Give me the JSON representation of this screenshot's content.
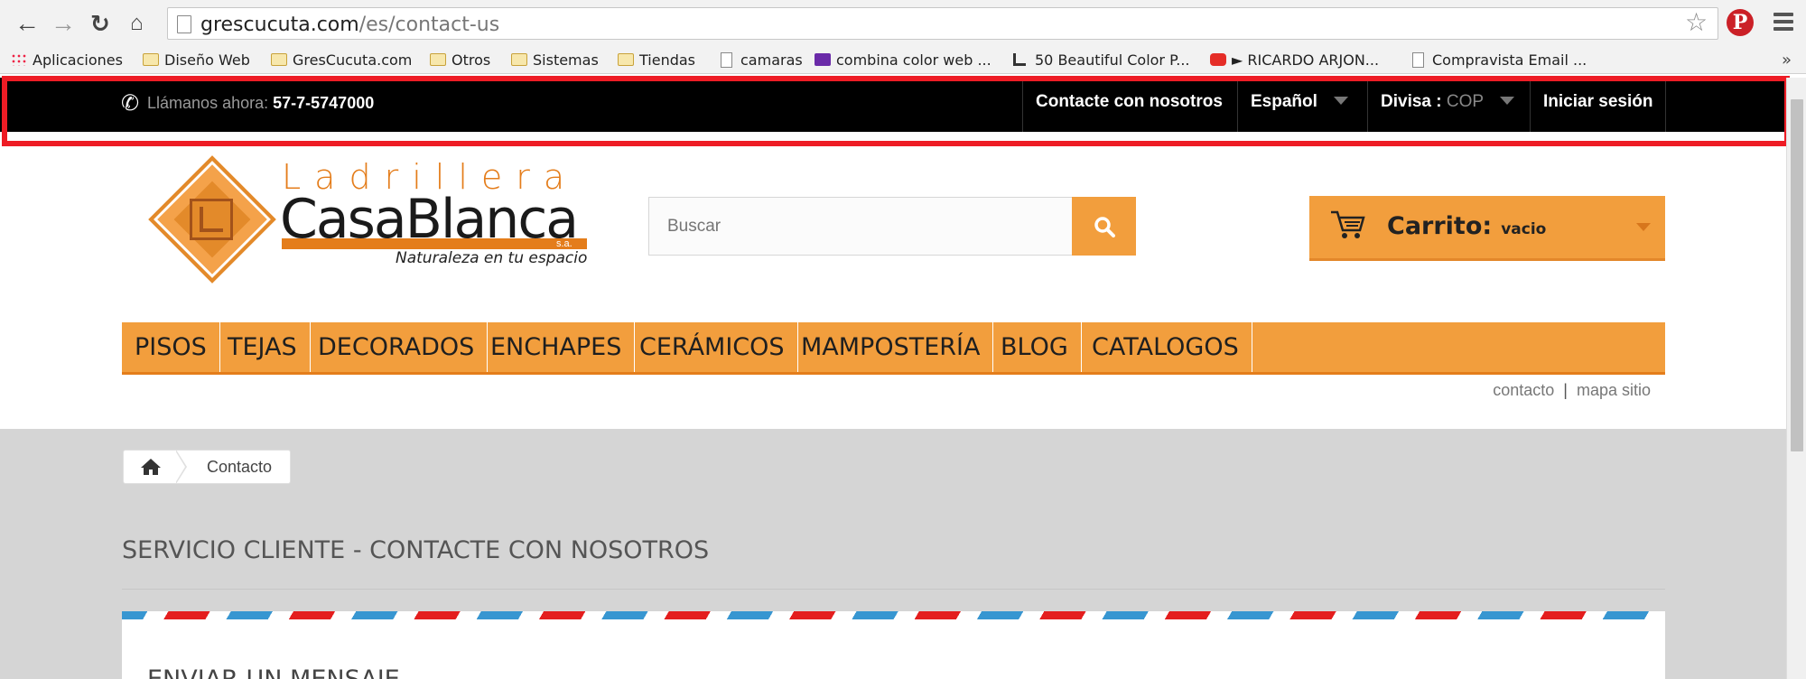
{
  "browser": {
    "url_domain": "grescucuta.com",
    "url_path": "/es/contact-us",
    "bookmarks": [
      "Aplicaciones",
      "Diseño Web",
      "GresCucuta.com",
      "Otros",
      "Sistemas",
      "Tiendas",
      "camaras",
      "combina color web ...",
      "50 Beautiful Color P...",
      "► RICARDO ARJON...",
      "Compravista Email ..."
    ],
    "pinterest_glyph": "P",
    "more_glyph": "»"
  },
  "topbar": {
    "call_label": "Llámanos ahora:",
    "phone": "57-7-5747000",
    "contact": "Contacte con nosotros",
    "language": "Español",
    "currency_label": "Divisa :",
    "currency_value": "COP",
    "login": "Iniciar sesión",
    "highlight_color": "#ee1c25"
  },
  "logo": {
    "line1": "Ladrillera",
    "line2": "CasaBlanca",
    "suffix": "s.a.",
    "tagline": "Naturaleza en tu espacio"
  },
  "search": {
    "placeholder": "Buscar",
    "icon": "search-icon"
  },
  "cart": {
    "label": "Carrito:",
    "value": "vacio",
    "icon": "cart-icon"
  },
  "menu": {
    "items": [
      "PISOS",
      "TEJAS",
      "DECORADOS",
      "ENCHAPES",
      "CERÁMICOS",
      "MAMPOSTERÍA",
      "BLOG",
      "CATALOGOS"
    ],
    "accent": "#f29e3d"
  },
  "sublinks": {
    "contact": "contacto",
    "sep": "|",
    "sitemap": "mapa sitio"
  },
  "breadcrumb": {
    "home_icon": "home-icon",
    "current": "Contacto"
  },
  "page": {
    "heading": "SERVICIO CLIENTE - CONTACTE CON NOSOTROS",
    "form_title": "ENVIAR UN MENSAJE"
  }
}
